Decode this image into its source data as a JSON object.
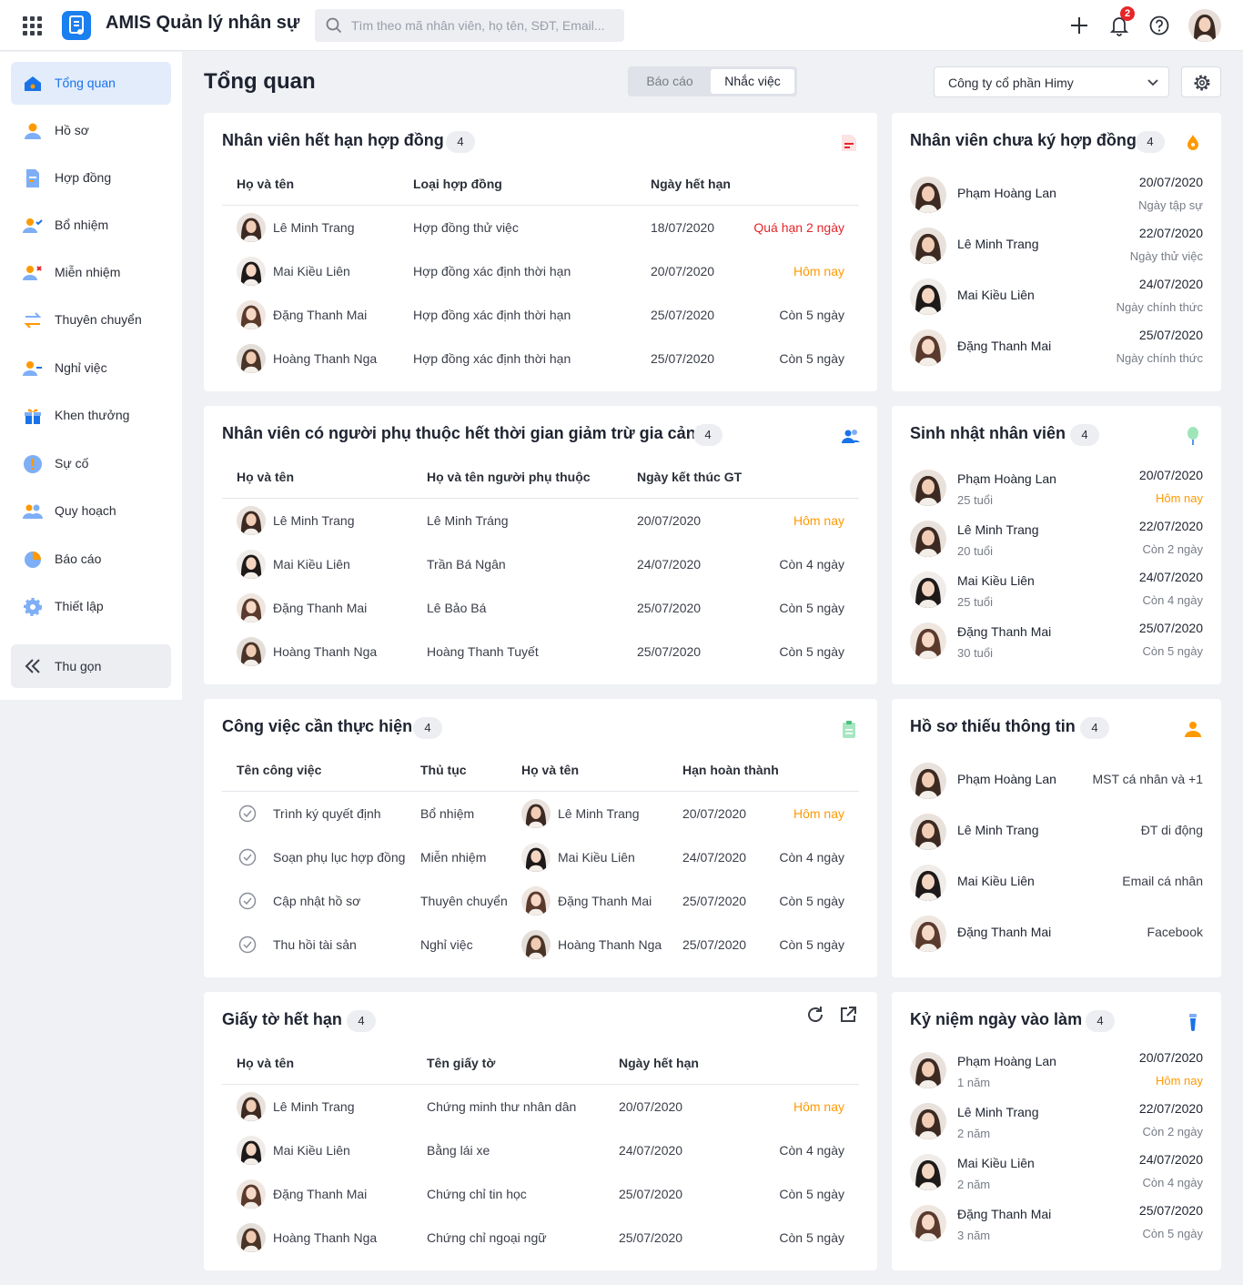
{
  "app": {
    "title": "AMIS Quản lý nhân sự",
    "search_placeholder": "Tìm theo mã nhân viên, họ tên, SĐT, Email...",
    "notification_count": "2"
  },
  "colors": {
    "primary": "#1a73e8",
    "accent_orange": "#ff9900",
    "overdue_red": "#e5262a"
  },
  "sidebar": {
    "items": [
      {
        "label": "Tổng quan",
        "icon": "home-icon",
        "active": true
      },
      {
        "label": "Hồ sơ",
        "icon": "profile-icon"
      },
      {
        "label": "Hợp đồng",
        "icon": "contract-icon"
      },
      {
        "label": "Bổ nhiệm",
        "icon": "appoint-icon"
      },
      {
        "label": "Miễn nhiệm",
        "icon": "dismiss-icon"
      },
      {
        "label": "Thuyên chuyển",
        "icon": "transfer-icon"
      },
      {
        "label": "Nghỉ việc",
        "icon": "resign-icon"
      },
      {
        "label": "Khen thưởng",
        "icon": "gift-icon"
      },
      {
        "label": "Sự cố",
        "icon": "alert-icon"
      },
      {
        "label": "Quy hoạch",
        "icon": "planning-icon"
      },
      {
        "label": "Báo cáo",
        "icon": "pie-chart-icon"
      },
      {
        "label": "Thiết lập",
        "icon": "gear-icon"
      }
    ],
    "collapse_label": "Thu gọn"
  },
  "header": {
    "page_title": "Tổng quan",
    "tabs": [
      "Báo cáo",
      "Nhắc việc"
    ],
    "active_tab": "Nhắc việc",
    "company": "Công ty cổ phần Himy"
  },
  "contracts_expiring": {
    "title": "Nhân viên hết hạn hợp đồng",
    "count": "4",
    "columns": [
      "Họ và tên",
      "Loại hợp đồng",
      "Ngày hết hạn"
    ],
    "rows": [
      {
        "name": "Lê Minh Trang",
        "type": "Hợp đồng thử việc",
        "date": "18/07/2020",
        "status": "Quá hạn 2 ngày",
        "tone": "red"
      },
      {
        "name": "Mai Kiều Liên",
        "type": "Hợp đồng xác định thời hạn",
        "date": "20/07/2020",
        "status": "Hôm nay",
        "tone": "orange"
      },
      {
        "name": "Đặng Thanh Mai",
        "type": "Hợp đồng xác định thời hạn",
        "date": "25/07/2020",
        "status": "Còn 5 ngày",
        "tone": "normal"
      },
      {
        "name": "Hoàng Thanh Nga",
        "type": "Hợp đồng xác định thời hạn",
        "date": "25/07/2020",
        "status": "Còn 5 ngày",
        "tone": "normal"
      }
    ]
  },
  "unsigned_contracts": {
    "title": "Nhân viên chưa ký hợp đồng",
    "count": "4",
    "items": [
      {
        "name": "Phạm Hoàng Lan",
        "date": "20/07/2020",
        "note": "Ngày tập sự"
      },
      {
        "name": "Lê Minh Trang",
        "date": "22/07/2020",
        "note": "Ngày thử việc"
      },
      {
        "name": "Mai Kiều Liên",
        "date": "24/07/2020",
        "note": "Ngày chính thức"
      },
      {
        "name": "Đặng Thanh Mai",
        "date": "25/07/2020",
        "note": "Ngày chính thức"
      }
    ]
  },
  "dependents": {
    "title": "Nhân viên có người phụ thuộc hết thời gian giảm trừ gia cảnh",
    "count": "4",
    "columns": [
      "Họ và tên",
      "Họ và tên người phụ thuộc",
      "Ngày kết thúc GT"
    ],
    "rows": [
      {
        "name": "Lê Minh Trang",
        "dependent": "Lê Minh Tráng",
        "date": "20/07/2020",
        "status": "Hôm nay",
        "tone": "orange"
      },
      {
        "name": "Mai Kiều Liên",
        "dependent": "Trần Bá Ngân",
        "date": "24/07/2020",
        "status": "Còn 4 ngày",
        "tone": "normal"
      },
      {
        "name": "Đặng Thanh Mai",
        "dependent": "Lê Bảo Bá",
        "date": "25/07/2020",
        "status": "Còn 5 ngày",
        "tone": "normal"
      },
      {
        "name": "Hoàng Thanh Nga",
        "dependent": "Hoàng Thanh Tuyết",
        "date": "25/07/2020",
        "status": "Còn 5 ngày",
        "tone": "normal"
      }
    ]
  },
  "birthdays": {
    "title": "Sinh nhật nhân viên",
    "count": "4",
    "items": [
      {
        "name": "Phạm Hoàng Lan",
        "sub": "25 tuổi",
        "date": "20/07/2020",
        "note": "Hôm nay",
        "tone": "orange"
      },
      {
        "name": "Lê Minh Trang",
        "sub": "20 tuổi",
        "date": "22/07/2020",
        "note": "Còn 2 ngày",
        "tone": "normal"
      },
      {
        "name": "Mai Kiều Liên",
        "sub": "25 tuổi",
        "date": "24/07/2020",
        "note": "Còn 4 ngày",
        "tone": "normal"
      },
      {
        "name": "Đặng Thanh Mai",
        "sub": "30 tuổi",
        "date": "25/07/2020",
        "note": "Còn 5 ngày",
        "tone": "normal"
      }
    ]
  },
  "tasks": {
    "title": "Công việc cần thực hiện",
    "count": "4",
    "columns": [
      "Tên công việc",
      "Thủ tục",
      "Họ và tên",
      "Hạn hoàn thành"
    ],
    "rows": [
      {
        "task": "Trình ký quyết định",
        "procedure": "Bổ nhiệm",
        "name": "Lê Minh Trang",
        "date": "20/07/2020",
        "status": "Hôm nay",
        "tone": "orange"
      },
      {
        "task": "Soạn phụ lục hợp đồng",
        "procedure": "Miễn nhiệm",
        "name": "Mai Kiều Liên",
        "date": "24/07/2020",
        "status": "Còn 4 ngày",
        "tone": "normal"
      },
      {
        "task": "Cập nhật hồ sơ",
        "procedure": "Thuyên chuyển",
        "name": "Đặng Thanh Mai",
        "date": "25/07/2020",
        "status": "Còn 5 ngày",
        "tone": "normal"
      },
      {
        "task": "Thu hồi tài sản",
        "procedure": "Nghỉ việc",
        "name": "Hoàng Thanh Nga",
        "date": "25/07/2020",
        "status": "Còn 5 ngày",
        "tone": "normal"
      }
    ]
  },
  "missing_info": {
    "title": "Hồ sơ thiếu thông tin",
    "count": "4",
    "items": [
      {
        "name": "Phạm Hoàng Lan",
        "missing": "MST cá nhân và +1"
      },
      {
        "name": "Lê Minh Trang",
        "missing": "ĐT di động"
      },
      {
        "name": "Mai Kiều Liên",
        "missing": "Email cá nhân"
      },
      {
        "name": "Đặng Thanh Mai",
        "missing": "Facebook"
      }
    ]
  },
  "documents": {
    "title": "Giấy tờ hết hạn",
    "count": "4",
    "columns": [
      "Họ và tên",
      "Tên giấy tờ",
      "Ngày hết hạn"
    ],
    "rows": [
      {
        "name": "Lê Minh Trang",
        "doc": "Chứng minh thư nhân dân",
        "date": "20/07/2020",
        "status": "Hôm nay",
        "tone": "orange"
      },
      {
        "name": "Mai Kiều Liên",
        "doc": "Bằng lái xe",
        "date": "24/07/2020",
        "status": "Còn 4 ngày",
        "tone": "normal"
      },
      {
        "name": "Đặng Thanh Mai",
        "doc": "Chứng chỉ tin học",
        "date": "25/07/2020",
        "status": "Còn 5 ngày",
        "tone": "normal"
      },
      {
        "name": "Hoàng Thanh Nga",
        "doc": "Chứng chỉ ngoại ngữ",
        "date": "25/07/2020",
        "status": "Còn 5 ngày",
        "tone": "normal"
      }
    ]
  },
  "anniversary": {
    "title": "Kỷ niệm ngày vào làm",
    "count": "4",
    "items": [
      {
        "name": "Phạm Hoàng Lan",
        "sub": "1 năm",
        "date": "20/07/2020",
        "note": "Hôm nay",
        "tone": "orange"
      },
      {
        "name": "Lê Minh Trang",
        "sub": "2 năm",
        "date": "22/07/2020",
        "note": "Còn 2 ngày",
        "tone": "normal"
      },
      {
        "name": "Mai Kiều Liên",
        "sub": "2 năm",
        "date": "24/07/2020",
        "note": "Còn 4 ngày",
        "tone": "normal"
      },
      {
        "name": "Đặng Thanh Mai",
        "sub": "3 năm",
        "date": "25/07/2020",
        "note": "Còn 5 ngày",
        "tone": "normal"
      }
    ]
  }
}
